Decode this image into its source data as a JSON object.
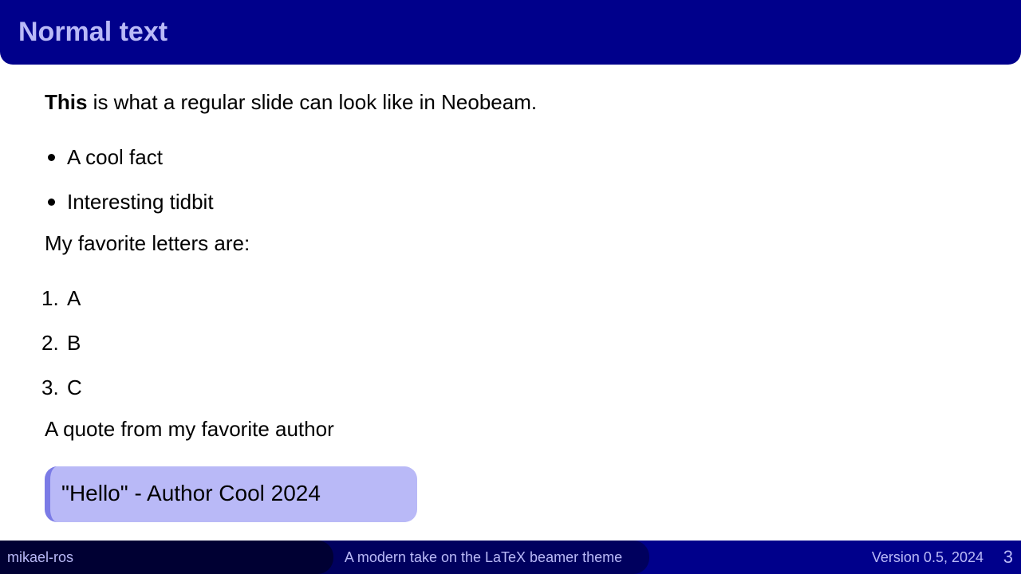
{
  "slide": {
    "title": "Normal text",
    "intro_bold": "This",
    "intro_rest": " is what a regular slide can look like in Neobeam.",
    "bullets": [
      "A cool fact",
      "Interesting tidbit"
    ],
    "letters_label": "My favorite letters are:",
    "letters": [
      {
        "n": "1.",
        "v": "A"
      },
      {
        "n": "2.",
        "v": "B"
      },
      {
        "n": "3.",
        "v": "C"
      }
    ],
    "quote_label": "A quote from my favorite author",
    "quote": "\"Hello\" - Author Cool 2024"
  },
  "footer": {
    "author": "mikael-ros",
    "subtitle": "A modern take on the LaTeX beamer theme",
    "version": "Version 0.5, 2024",
    "page": "3"
  },
  "colors": {
    "header_bg": "#00008b",
    "title_text": "#b9b9f7",
    "quote_bg": "#b9b9f7",
    "quote_accent": "#7b7be6"
  }
}
